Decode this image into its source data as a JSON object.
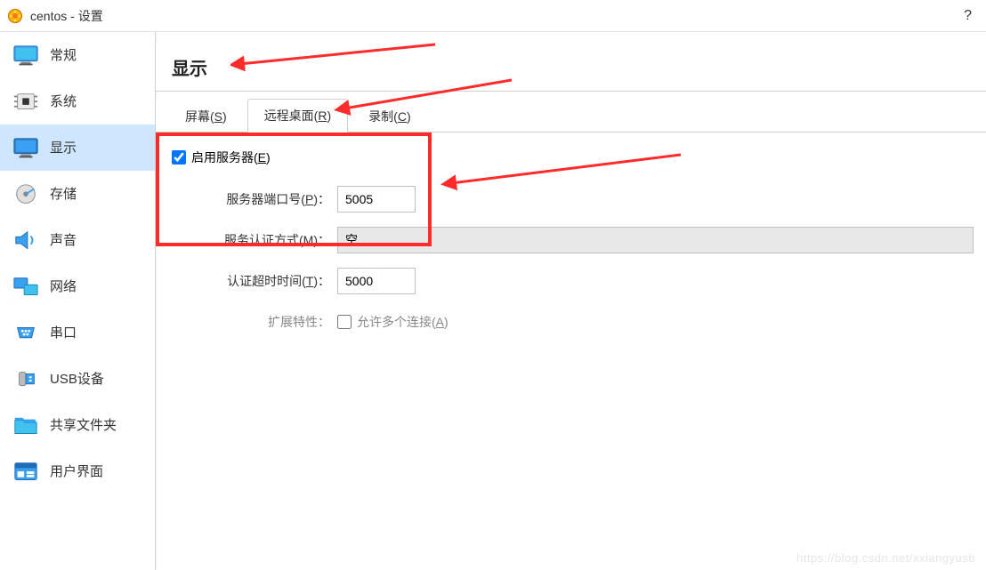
{
  "window": {
    "title": "centos - 设置",
    "help_symbol": "?"
  },
  "sidebar": {
    "items": [
      {
        "label": "常规",
        "icon": "monitor-general"
      },
      {
        "label": "系统",
        "icon": "chip"
      },
      {
        "label": "显示",
        "icon": "monitor-display",
        "selected": true
      },
      {
        "label": "存储",
        "icon": "disk"
      },
      {
        "label": "声音",
        "icon": "speaker"
      },
      {
        "label": "网络",
        "icon": "network-monitors"
      },
      {
        "label": "串口",
        "icon": "serial-port"
      },
      {
        "label": "USB设备",
        "icon": "usb"
      },
      {
        "label": "共享文件夹",
        "icon": "folder-shared"
      },
      {
        "label": "用户界面",
        "icon": "ui-window"
      }
    ]
  },
  "page": {
    "title": "显示",
    "tabs": [
      {
        "label_pre": "屏幕(",
        "hotkey": "S",
        "label_post": ")",
        "active": false
      },
      {
        "label_pre": "远程桌面(",
        "hotkey": "R",
        "label_post": ")",
        "active": true
      },
      {
        "label_pre": "录制(",
        "hotkey": "C",
        "label_post": ")",
        "active": false
      }
    ],
    "enable_server": {
      "label_pre": "启用服务器(",
      "hotkey": "E",
      "label_post": ")",
      "checked": true
    },
    "fields": {
      "port": {
        "label_pre": "服务器端口号(",
        "hotkey": "P",
        "label_post": ")：",
        "value": "5005"
      },
      "auth_method": {
        "label_pre": "服务认证方式(",
        "hotkey": "M",
        "label_post": ")：",
        "value": "空"
      },
      "auth_timeout": {
        "label_pre": "认证超时时间(",
        "hotkey": "T",
        "label_post": ")：",
        "value": "5000"
      },
      "extension": {
        "label": "扩展特性：",
        "checkbox_label_pre": "允许多个连接(",
        "checkbox_hotkey": "A",
        "checkbox_label_post": ")",
        "checked": false
      }
    }
  },
  "watermark": "https://blog.csdn.net/xxiangyusb"
}
